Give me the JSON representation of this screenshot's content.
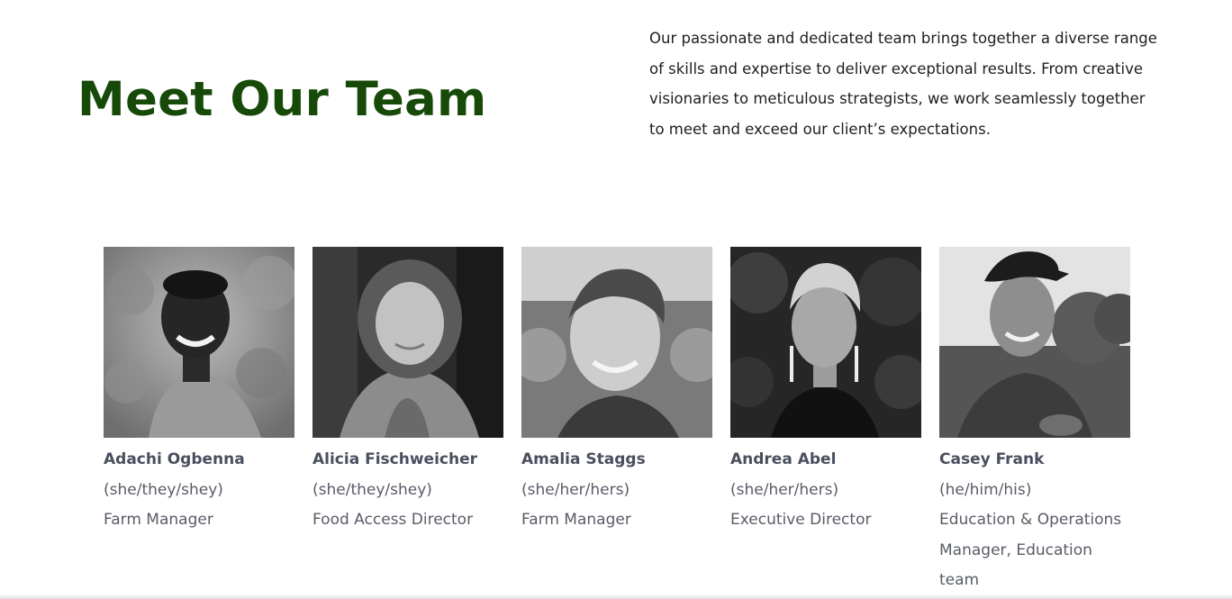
{
  "header": {
    "title": "Meet Our Team",
    "intro": "Our passionate and dedicated team brings together a diverse range of skills and expertise to deliver exceptional results. From creative visionaries to meticulous strategists, we work seamlessly together to meet and exceed our client’s expectations."
  },
  "colors": {
    "title_green": "#174a08",
    "member_text": "#4a4f5e"
  },
  "team": [
    {
      "name": "Adachi Ogbenna",
      "pronouns": "(she/they/shey)",
      "role": "Farm Manager"
    },
    {
      "name": "Alicia Fischweicher",
      "pronouns": "(she/they/shey)",
      "role": "Food Access Director"
    },
    {
      "name": "Amalia Staggs",
      "pronouns": "(she/her/hers)",
      "role": "Farm Manager"
    },
    {
      "name": "Andrea Abel",
      "pronouns": "(she/her/hers)",
      "role": "Executive Director"
    },
    {
      "name": "Casey Frank",
      "pronouns": "(he/him/his)",
      "role": "Education & Operations Manager, Education team"
    }
  ]
}
